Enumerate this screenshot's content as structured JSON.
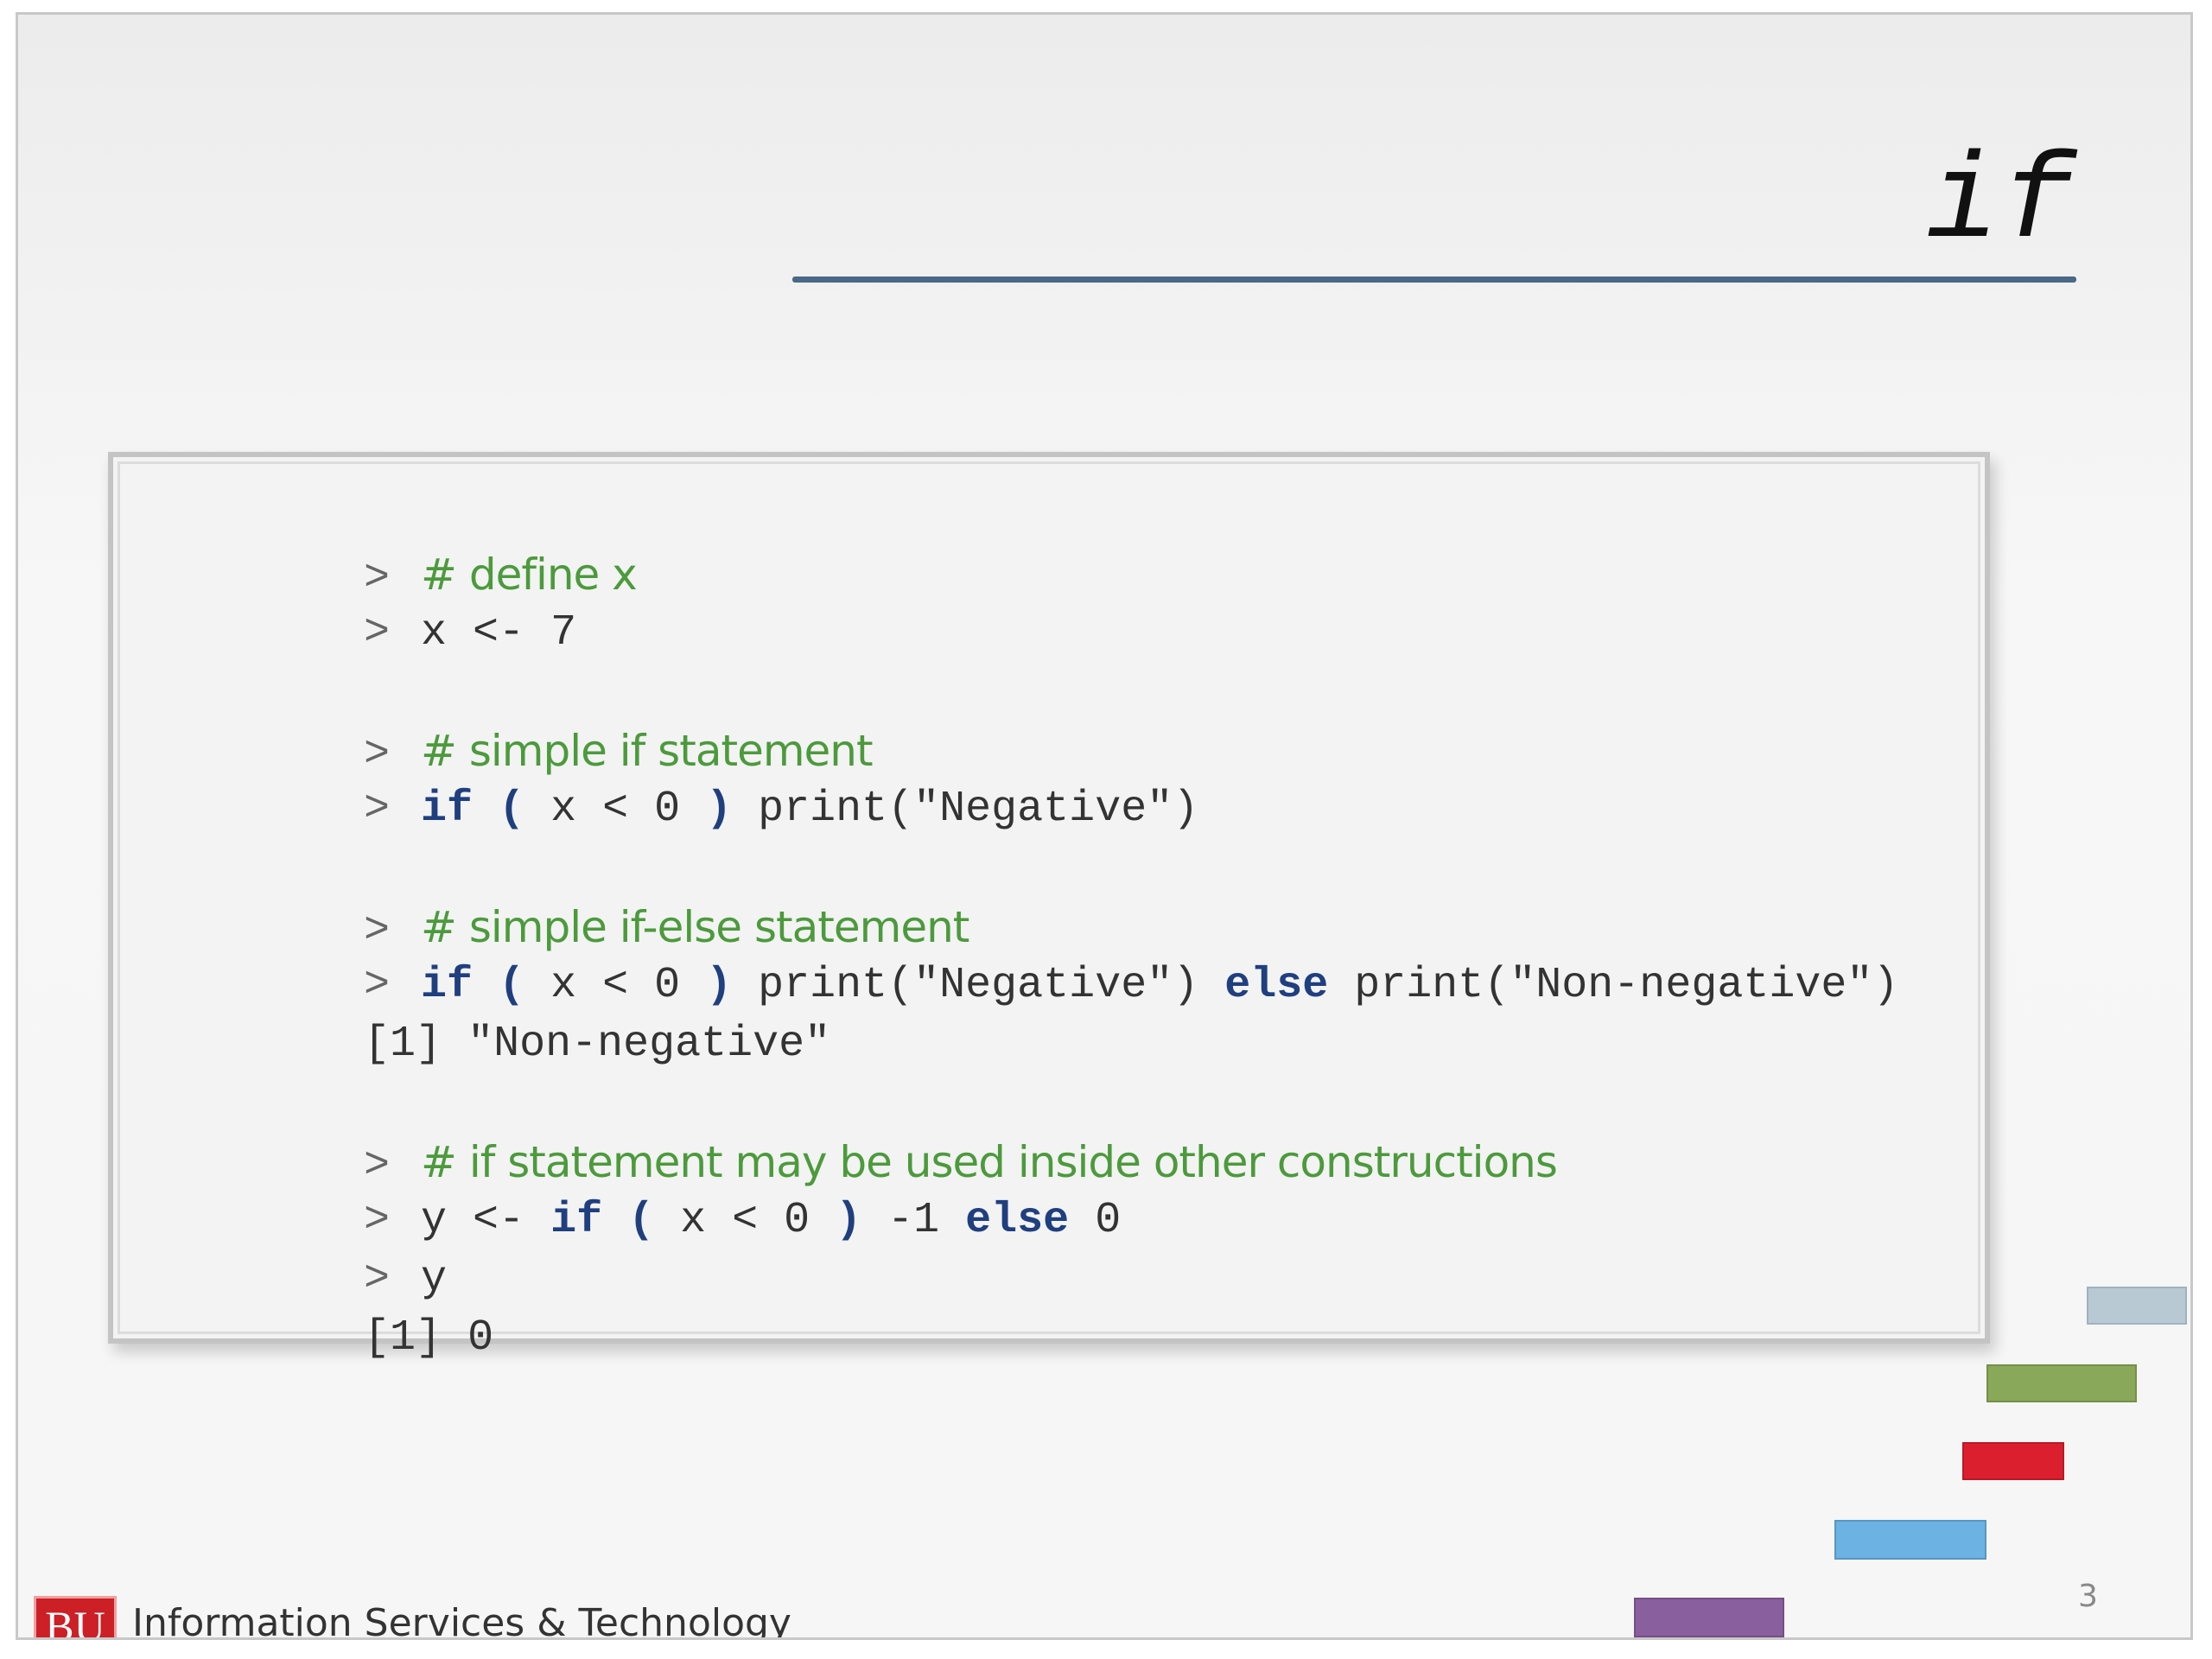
{
  "slide": {
    "title": "if",
    "page_number": "3",
    "footer": {
      "logo_text": "BU",
      "organization": "Information Services & Technology"
    }
  },
  "code": {
    "prompt": ">",
    "line1_comment": "# define x",
    "line2_code": "x <- 7",
    "line4_comment_a": "# simple ",
    "line4_comment_b": "if",
    "line4_comment_c": " statement",
    "line5_kw": "if",
    "line5_paren_open": " ( ",
    "line5_cond": "x < 0",
    "line5_paren_close": " ) ",
    "line5_rest": "print(\"Negative\")",
    "line7_comment_a": "# simple ",
    "line7_comment_b": "if-else",
    "line7_comment_c": " statement",
    "line8_kw": "if",
    "line8_paren_open": " ( ",
    "line8_cond": "x < 0",
    "line8_paren_close": " ) ",
    "line8_mid": "print(\"Negative\") ",
    "line8_else": "else",
    "line8_rest": " print(\"Non-negative\")",
    "line9_output": "[1] \"Non-negative\"",
    "line11_comment_a": "# ",
    "line11_comment_b": "if",
    "line11_comment_c": " statement may be used inside other constructions",
    "line12_a": "y <- ",
    "line12_kw": "if",
    "line12_paren_open": " ( ",
    "line12_cond": "x < 0",
    "line12_paren_close": " ) ",
    "line12_mid": "-1 ",
    "line12_else": "else",
    "line12_rest": " 0",
    "line13_code": "y",
    "line14_output": "[1] 0"
  },
  "decorations": {
    "colors": {
      "gray_blue": "#b8c9d4",
      "green": "#8aa85a",
      "red": "#dc1f2e",
      "light_blue": "#6cb2e2",
      "purple": "#8a5f9e"
    }
  }
}
